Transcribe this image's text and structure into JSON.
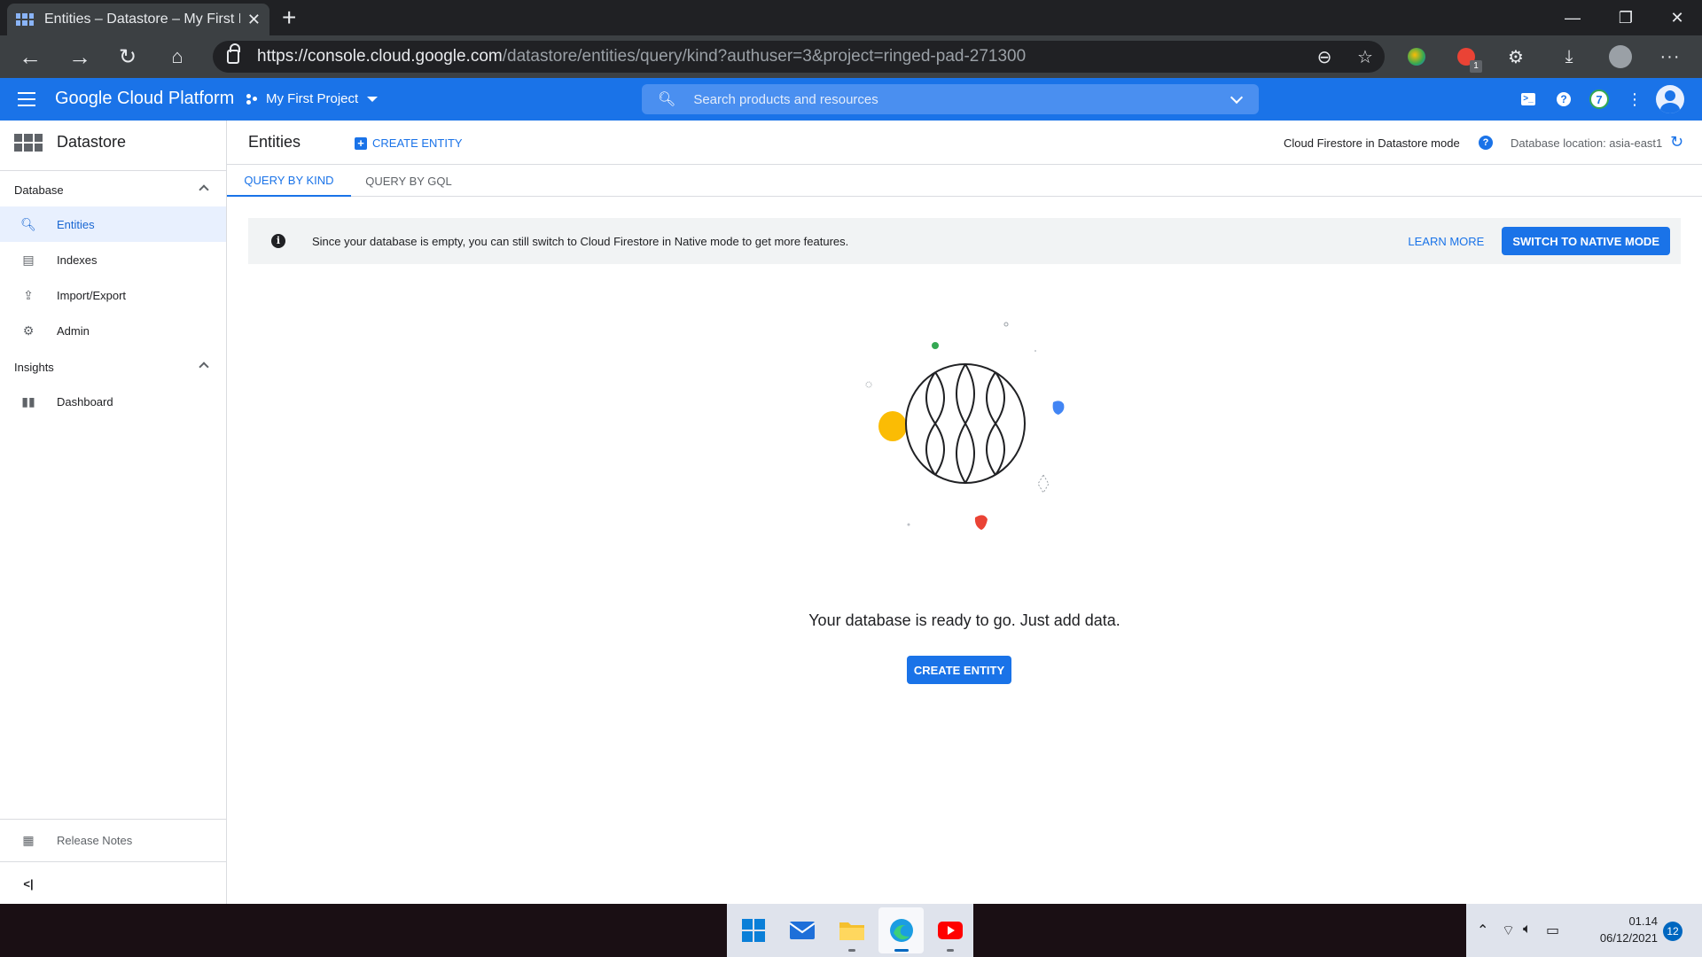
{
  "browser": {
    "tab_title": "Entities – Datastore – My First Pr",
    "url_host": "https://console.cloud.google.com",
    "url_path": "/datastore/entities/query/kind?authuser=3&project=ringed-pad-271300",
    "ext_badge": "1"
  },
  "header": {
    "brand": "Google Cloud Platform",
    "project": "My First Project",
    "search_placeholder": "Search products and resources",
    "notification_count": "7"
  },
  "sidebar": {
    "title": "Datastore",
    "sections": [
      {
        "label": "Database"
      },
      {
        "label": "Insights"
      }
    ],
    "items": [
      {
        "label": "Entities",
        "icon": "search-icon"
      },
      {
        "label": "Indexes",
        "icon": "indexes-icon"
      },
      {
        "label": "Import/Export",
        "icon": "import-export-icon"
      },
      {
        "label": "Admin",
        "icon": "gear-icon"
      },
      {
        "label": "Dashboard",
        "icon": "bar-chart-icon"
      }
    ],
    "release_notes": "Release Notes",
    "collapse": "<|"
  },
  "main": {
    "title": "Entities",
    "create_entity_top": "CREATE ENTITY",
    "firestore_mode": "Cloud Firestore in Datastore mode",
    "db_location": "Database location: asia-east1",
    "tabs": [
      {
        "label": "QUERY BY KIND"
      },
      {
        "label": "QUERY BY GQL"
      }
    ],
    "banner": {
      "message": "Since your database is empty, you can still switch to Cloud Firestore in Native mode to get more features.",
      "learn_more": "LEARN MORE",
      "switch_button": "SWITCH TO NATIVE MODE"
    },
    "ready_text": "Your database is ready to go. Just add data.",
    "create_entity_button": "CREATE ENTITY"
  },
  "taskbar": {
    "time": "01.14",
    "date": "06/12/2021",
    "notifications": "12"
  },
  "colors": {
    "accent": "#1a73e8",
    "illustration_yellow": "#fbbc04",
    "illustration_blue": "#4285f4",
    "illustration_red": "#ea4335",
    "illustration_green": "#34a853"
  }
}
